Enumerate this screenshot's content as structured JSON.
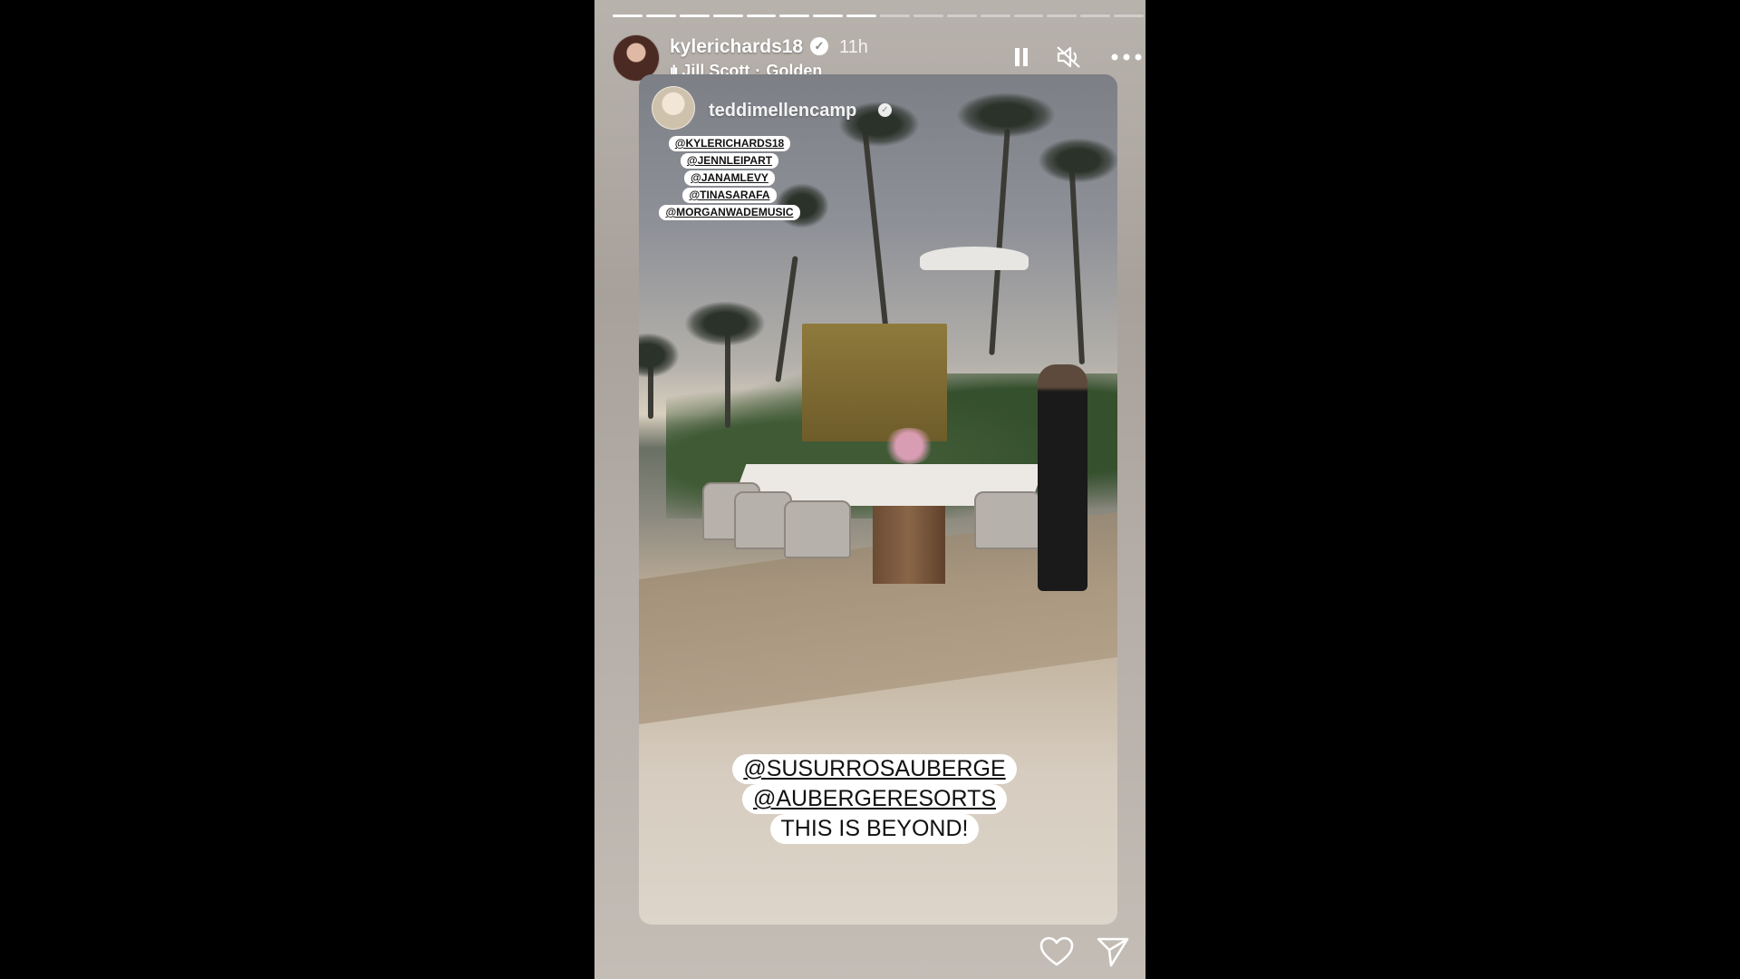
{
  "story": {
    "progress_total": 16,
    "progress_done": 8,
    "username": "kylerichards18",
    "time": "11h",
    "music_artist": "Jill Scott",
    "music_separator": "·",
    "music_track": "Golden"
  },
  "controls": {
    "pause_icon": "pause-icon",
    "mute_icon": "mute-icon",
    "more_icon": "more-icon"
  },
  "reshare": {
    "username": "teddimellencamp",
    "mentions": [
      "@KYLERICHARDS18",
      "@JENNLEIPART",
      "@JANAMLEVY",
      "@TINASARAFA",
      "@MORGANWADEMUSIC"
    ],
    "caption": [
      "@SUSURROSAUBERGE",
      "@AUBERGERESORTS",
      "THIS IS BEYOND!"
    ]
  },
  "footer": {
    "like_icon": "heart-icon",
    "share_icon": "send-icon"
  }
}
